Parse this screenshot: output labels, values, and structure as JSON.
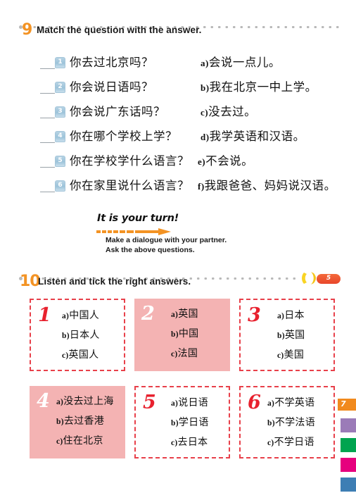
{
  "page": {
    "page_number": "7",
    "edge_colors": [
      "#9b7bb8",
      "#00a44f",
      "#e6007e",
      "#3d7eb4"
    ],
    "page_tab_color": "#f18a1e"
  },
  "exercise9": {
    "number": "9",
    "title": "Match the question with the answer.",
    "questions": [
      {
        "num": "1",
        "text": "你去过北京吗？"
      },
      {
        "num": "2",
        "text": "你会说日语吗？"
      },
      {
        "num": "3",
        "text": "你会说广东话吗？"
      },
      {
        "num": "4",
        "text": "你在哪个学校上学？"
      },
      {
        "num": "5",
        "text": "你在学校学什么语言？"
      },
      {
        "num": "6",
        "text": "你在家里说什么语言？"
      }
    ],
    "answers": [
      {
        "label": "a)",
        "text": "会说一点儿。"
      },
      {
        "label": "b)",
        "text": "我在北京一中上学。"
      },
      {
        "label": "c)",
        "text": "没去过。"
      },
      {
        "label": "d)",
        "text": "我学英语和汉语。"
      },
      {
        "label": "e)",
        "text": "不会说。"
      },
      {
        "label": "f)",
        "text": "我跟爸爸、妈妈说汉语。"
      }
    ]
  },
  "your_turn": {
    "heading": "It is your turn!",
    "line1": "Make a dialogue with your partner.",
    "line2": "Ask the above questions.",
    "arrow_color": "#f39324"
  },
  "exercise10": {
    "number": "10",
    "title": "Listen and tick the right answers.",
    "audio_track": "5",
    "boxes": [
      {
        "num": "1",
        "style": "white",
        "options": [
          {
            "label": "a)",
            "text": "中国人"
          },
          {
            "label": "b)",
            "text": "日本人"
          },
          {
            "label": "c)",
            "text": "英国人"
          }
        ]
      },
      {
        "num": "2",
        "style": "pink",
        "options": [
          {
            "label": "a)",
            "text": "英国"
          },
          {
            "label": "b)",
            "text": "中国"
          },
          {
            "label": "c)",
            "text": "法国"
          }
        ]
      },
      {
        "num": "3",
        "style": "white",
        "options": [
          {
            "label": "a)",
            "text": "日本"
          },
          {
            "label": "b)",
            "text": "英国"
          },
          {
            "label": "c)",
            "text": "美国"
          }
        ]
      },
      {
        "num": "4",
        "style": "pink",
        "options": [
          {
            "label": "a)",
            "text": "没去过上海"
          },
          {
            "label": "b)",
            "text": "去过香港"
          },
          {
            "label": "c)",
            "text": "住在北京"
          }
        ]
      },
      {
        "num": "5",
        "style": "white",
        "options": [
          {
            "label": "a)",
            "text": "说日语"
          },
          {
            "label": "b)",
            "text": "学日语"
          },
          {
            "label": "c)",
            "text": "去日本"
          }
        ]
      },
      {
        "num": "6",
        "style": "white",
        "options": [
          {
            "label": "a)",
            "text": "不学英语"
          },
          {
            "label": "b)",
            "text": "不学法语"
          },
          {
            "label": "c)",
            "text": "不学日语"
          }
        ]
      }
    ]
  }
}
